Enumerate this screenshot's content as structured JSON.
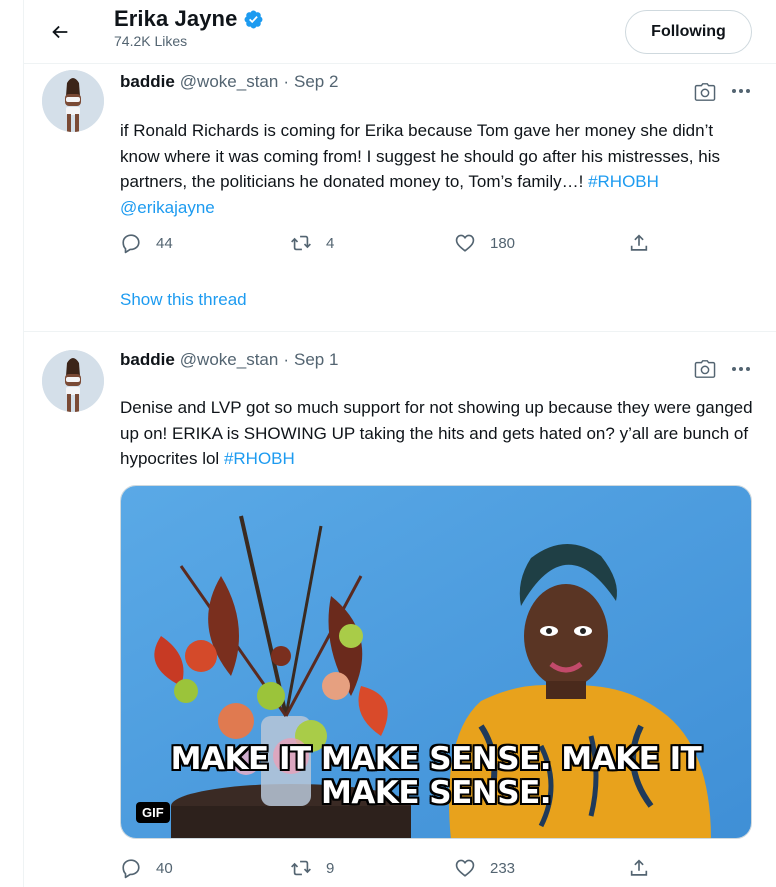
{
  "header": {
    "title": "Erika Jayne",
    "likes": "74.2K Likes",
    "follow_label": "Following",
    "verified_color": "#1d9bf0"
  },
  "tweets": [
    {
      "author": "baddie",
      "handle": "@woke_stan",
      "sep": "·",
      "date": "Sep 2",
      "text": "if Ronald Richards is coming for Erika because Tom gave her money she didn’t know where it was coming from! I suggest he should go after his mistresses, his partners, the politicians he donated money to, Tom’s family…! ",
      "hashtag": "#RHOBH",
      "mention": "@erikajayne",
      "replies": "44",
      "retweets": "4",
      "likes": "180",
      "show_thread": "Show this thread"
    },
    {
      "author": "baddie",
      "handle": "@woke_stan",
      "sep": "·",
      "date": "Sep 1",
      "text": "Denise and LVP got so much support for not showing up because they were ganged up on! ERIKA is SHOWING UP taking the hits and gets hated on? y’all are bunch of hypocrites lol ",
      "hashtag": "#RHOBH",
      "media": {
        "caption_line1": "MAKE IT MAKE SENSE. MAKE IT",
        "caption_line2": "MAKE SENSE.",
        "badge": "GIF"
      },
      "replies": "40",
      "retweets": "9",
      "likes": "233"
    }
  ],
  "icons": {
    "back": "arrow-left-icon",
    "verified": "verified-badge-icon",
    "camera": "camera-icon",
    "more": "more-icon",
    "reply": "reply-icon",
    "retweet": "retweet-icon",
    "like": "heart-icon",
    "share": "share-icon"
  },
  "colors": {
    "accent": "#1d9bf0",
    "text_primary": "#0f1419",
    "text_secondary": "#536471",
    "border": "#eff3f4"
  }
}
